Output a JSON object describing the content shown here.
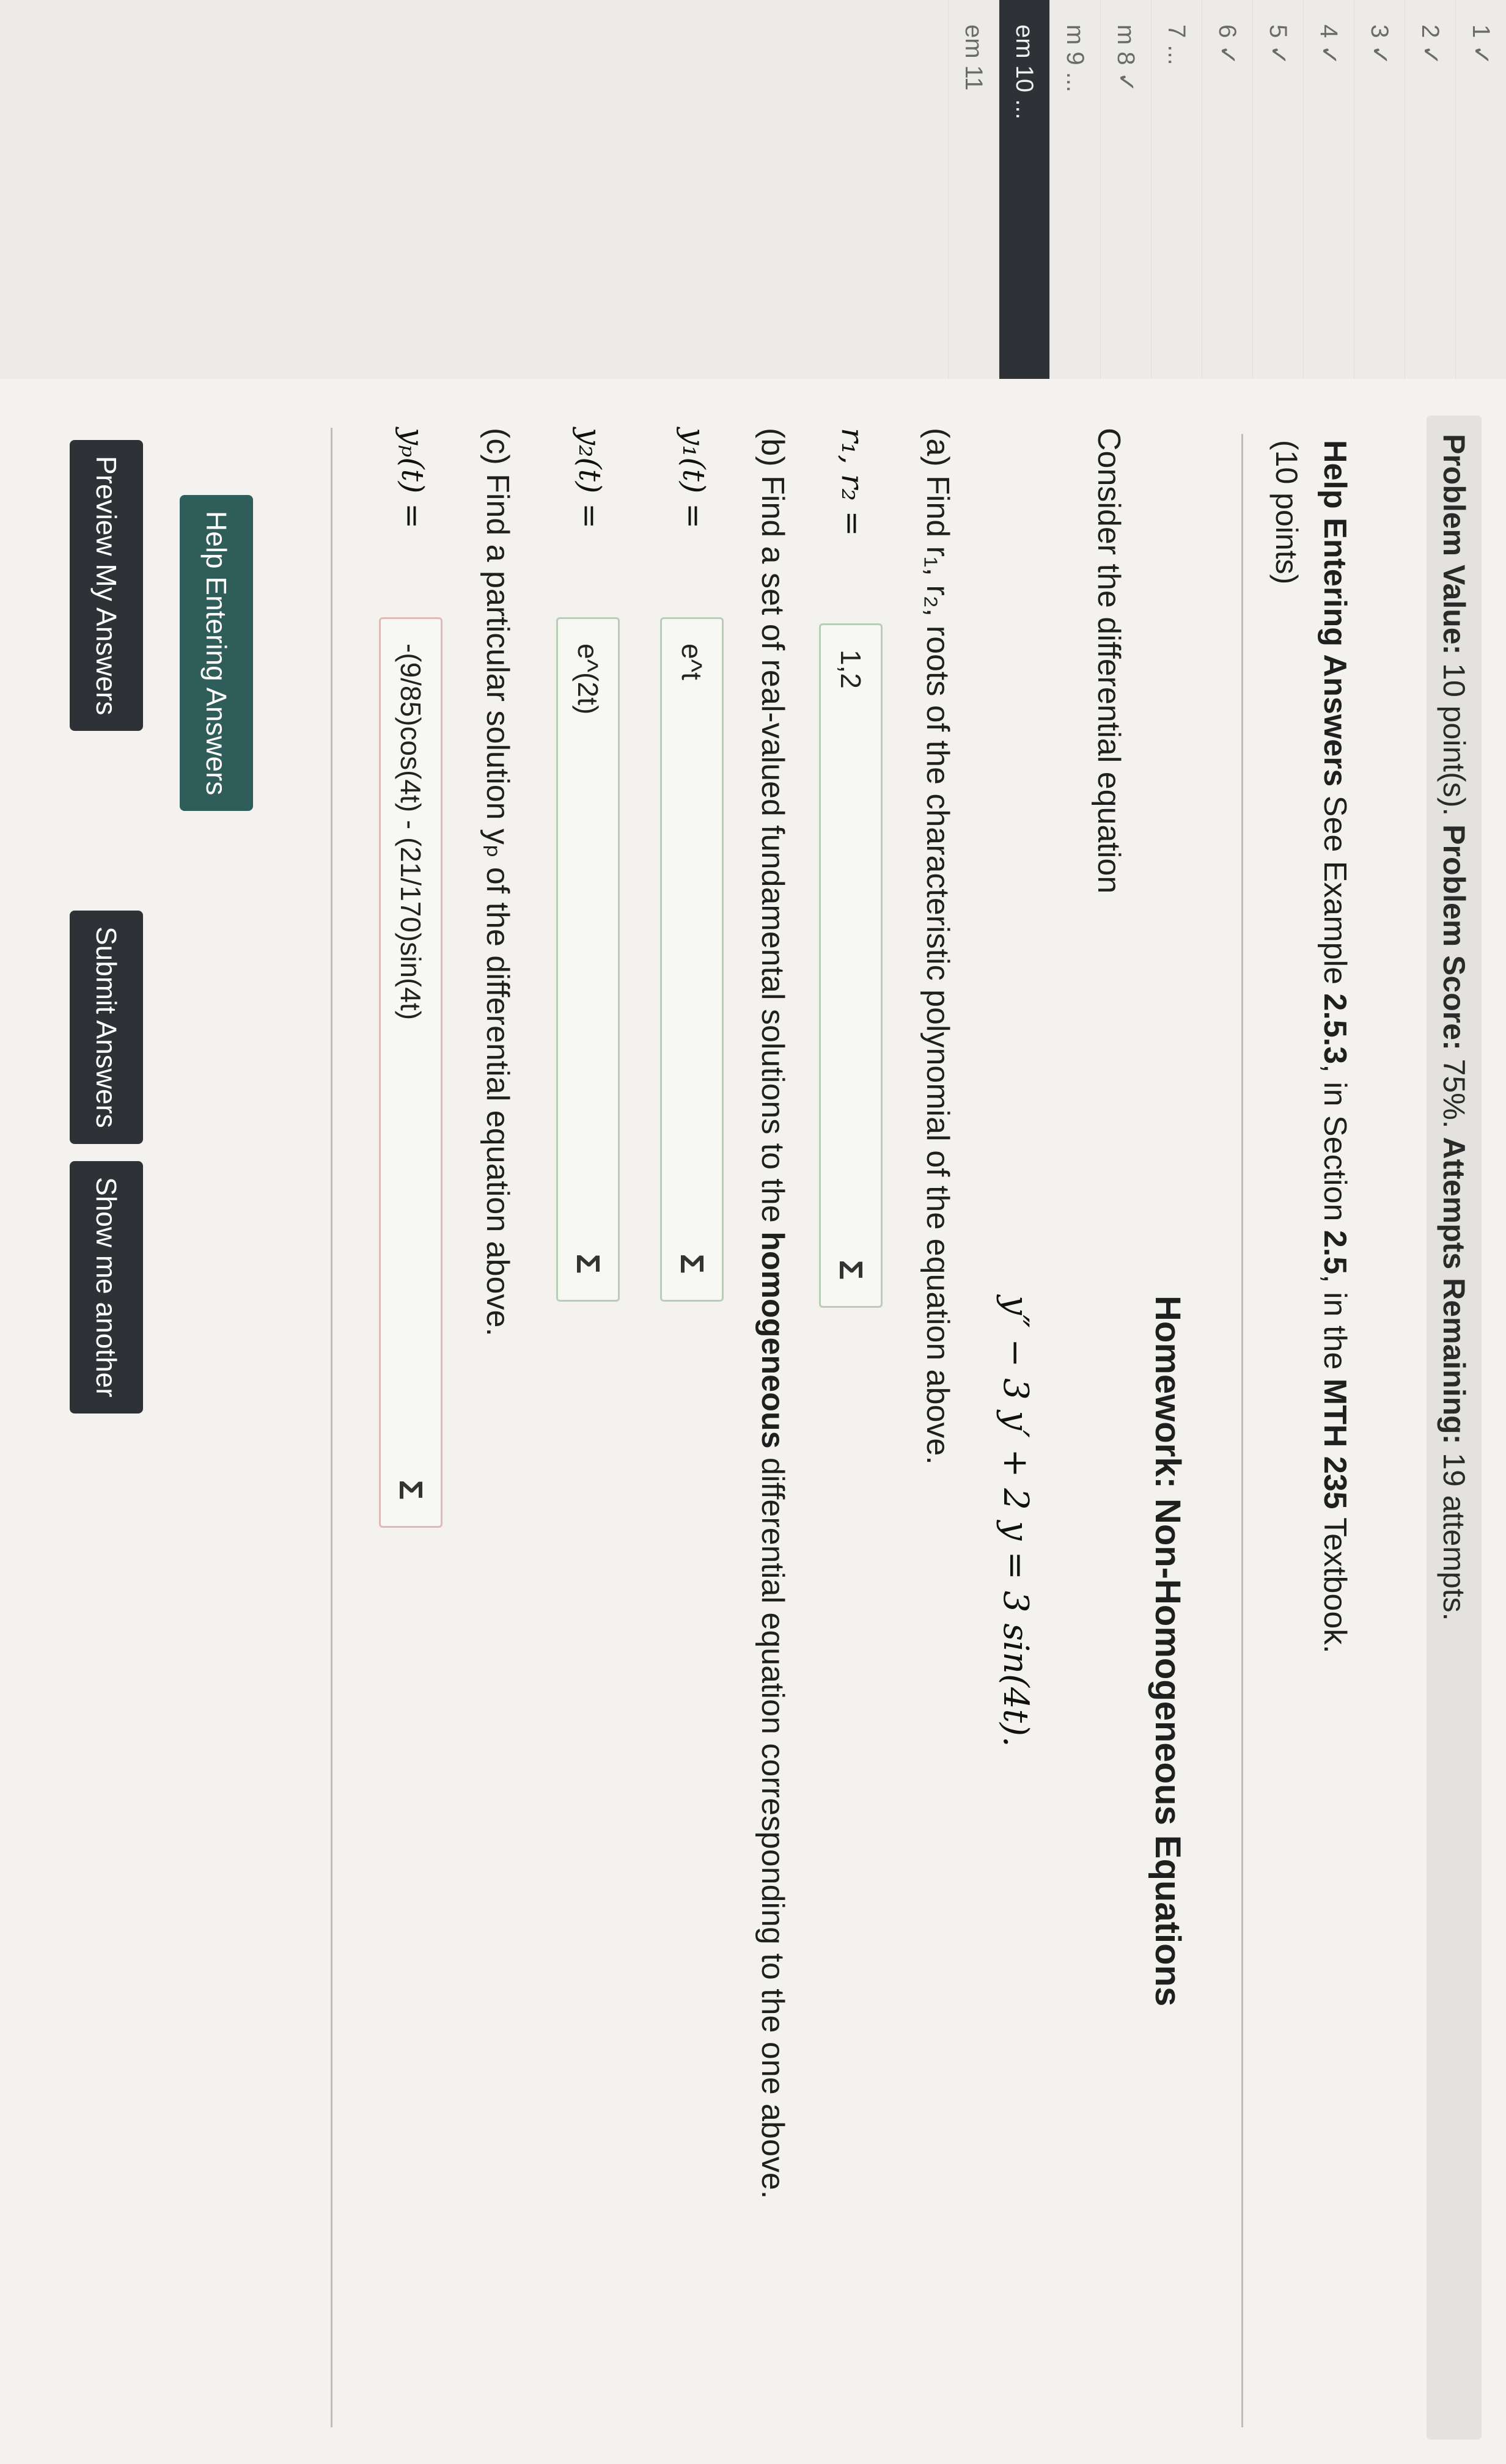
{
  "sidebar": {
    "items": [
      {
        "label": "1 ✓"
      },
      {
        "label": "2 ✓"
      },
      {
        "label": "3 ✓"
      },
      {
        "label": "4 ✓"
      },
      {
        "label": "5 ✓"
      },
      {
        "label": "6 ✓"
      },
      {
        "label": "7 ..."
      },
      {
        "label": "m 8 ✓"
      },
      {
        "label": "m 9 ..."
      },
      {
        "label": "em 10 ..."
      },
      {
        "label": "em 11"
      }
    ]
  },
  "status": {
    "value_label": "Problem Value:",
    "value_text": "10 point(s).",
    "score_label": "Problem Score:",
    "score_text": "75%.",
    "attempts_label": "Attempts Remaining:",
    "attempts_text": "19 attempts."
  },
  "help": {
    "label": "Help Entering Answers",
    "text_pre": "See Example",
    "example": "2.5.3",
    "text_mid": ", in Section",
    "section": "2.5",
    "text_mid2": ", in the",
    "book": "MTH 235",
    "text_post": "Textbook.",
    "points": "(10 points)"
  },
  "problem": {
    "title": "Homework: Non-Homogeneous Equations",
    "consider": "Consider the differential equation",
    "equation": "y″ − 3 y′ + 2 y = 3 sin(4t).",
    "part_a": "(a) Find r₁, r₂, roots of the characteristic polynomial of the equation above.",
    "part_b_pre": "(b) Find a set of real-valued fundamental solutions to the",
    "part_b_bold": "homogeneous",
    "part_b_post": "differential equation corresponding to the one above.",
    "part_c": "(c) Find a particular solution yₚ of the differential equation above."
  },
  "answers": {
    "roots_label": "r₁, r₂ =",
    "roots_value": "1,2",
    "y1_label": "y₁(t) =",
    "y1_value": "e^t",
    "y2_label": "y₂(t) =",
    "y2_value": "e^(2t)",
    "yp_label": "yₚ(t) =",
    "yp_value": "-(9/85)cos(4t) - (21/170)sin(4t)",
    "sigma": "Σ"
  },
  "buttons": {
    "help": "Help Entering Answers",
    "preview": "Preview My Answers",
    "submit": "Submit Answers",
    "another": "Show me another"
  }
}
